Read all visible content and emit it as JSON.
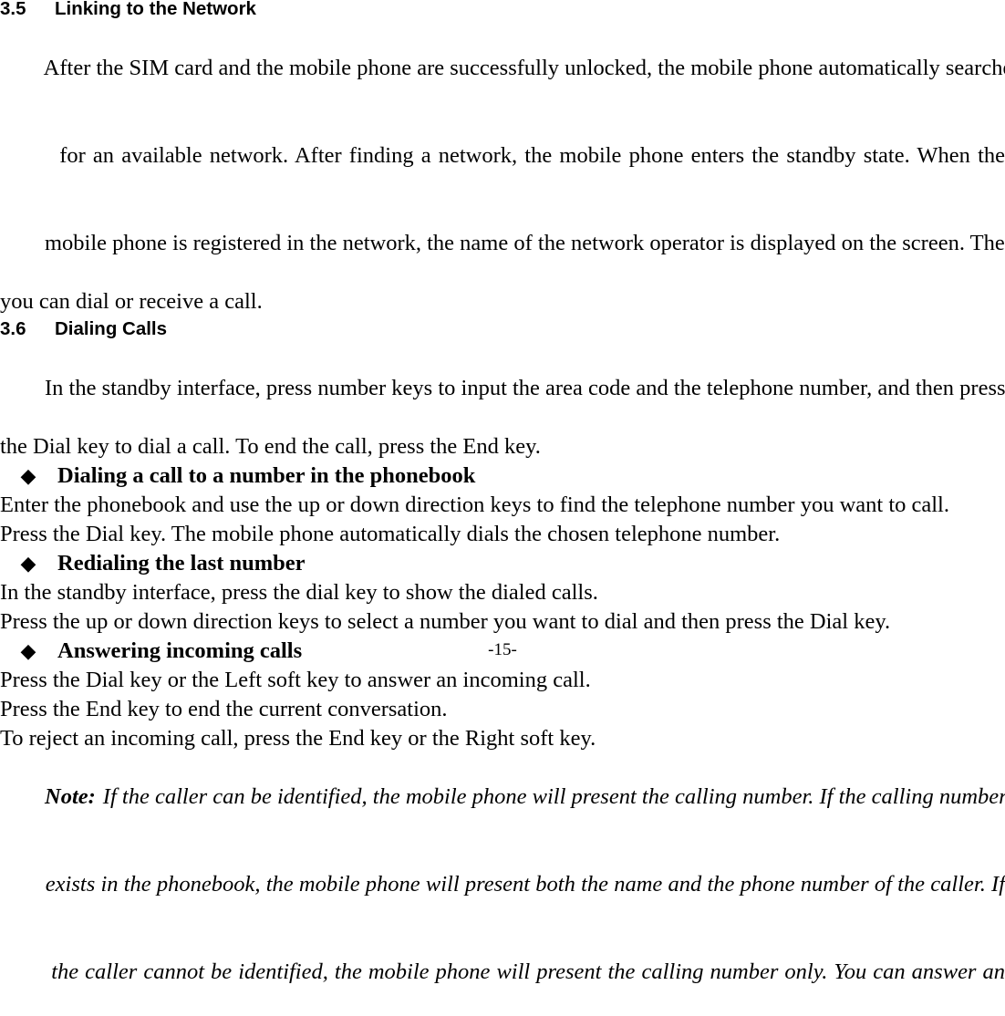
{
  "document": {
    "page_number": "-15-",
    "footer_text": "-15-",
    "bullet_glyph": "◆"
  },
  "sections": [
    {
      "number": "3.5",
      "title": "Linking to the Network",
      "paragraph_lines": [
        "After the SIM card and the mobile phone are successfully unlocked, the mobile phone automatically searches",
        "for an available network. After finding a network, the mobile phone enters the standby state. When the",
        "mobile phone is registered in the network, the name of the network operator is displayed on the screen. Then",
        "you can dial or receive a call."
      ],
      "paragraph_full": "After the SIM card and the mobile phone are successfully unlocked, the mobile phone automatically searches for an available network. After finding a network, the mobile phone enters the standby state. When the mobile phone is registered in the network, the name of the network operator is displayed on the screen. Then you can dial or receive a call."
    },
    {
      "number": "3.6",
      "title": "Dialing Calls",
      "paragraph_lines": [
        "In the standby interface, press number keys to input the area code and the telephone number, and then press",
        "the Dial key to dial a call. To end the call, press the End key."
      ],
      "paragraph_full": "In the standby interface, press number keys to input the area code and the telephone number, and then press the Dial key to dial a call. To end the call, press the End key."
    }
  ],
  "bullets": [
    {
      "label": "Dialing a call to a number in the phonebook",
      "lines": [
        "Enter the phonebook and use the up or down direction keys to find the telephone number you want to call.",
        "Press the Dial key. The mobile phone automatically dials the chosen telephone number."
      ]
    },
    {
      "label": "Redialing the last number",
      "lines": [
        "In the standby interface, press the dial key to show the dialed calls.",
        "Press the up or down direction keys to select a number you want to dial and then press the Dial key."
      ]
    },
    {
      "label": "Answering incoming calls",
      "lines": [
        "Press the Dial key or the Left soft key to answer an incoming call.",
        "Press the End key to end the current conversation.",
        "To reject an incoming call, press the End key or the Right soft key."
      ]
    }
  ],
  "note": {
    "label": "Note:",
    "lines": [
      "If the caller can be identified, the mobile phone will present the calling number. If the calling number",
      "exists in the phonebook, the mobile phone will present both the name and the phone number of the caller. If",
      "the caller cannot be identified, the mobile phone will present the calling number only. You can answer an"
    ],
    "text": "If the caller can be identified, the mobile phone will present the calling number. If the calling number exists in the phonebook, the mobile phone will present both the name and the phone number of the caller. If the caller cannot be identified, the mobile phone will present the calling number only. You can answer an"
  }
}
